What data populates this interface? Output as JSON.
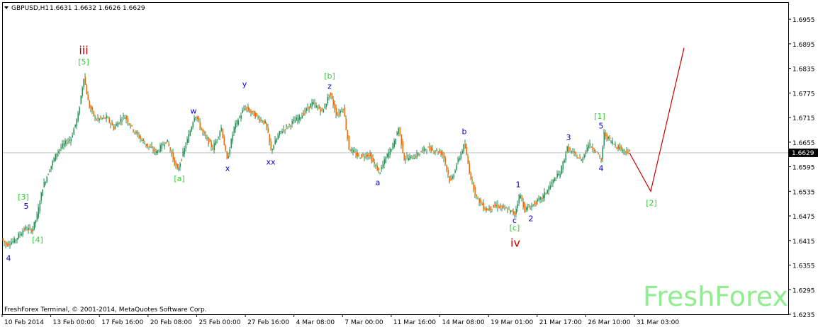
{
  "header": {
    "symbol": "GBPUSD,H1",
    "ohlc": "1.6631 1.6632 1.6626 1.6629"
  },
  "footer": {
    "copyright": "FreshForex Terminal, © 2001-2014, MetaQuotes Software Corp."
  },
  "watermark": "FreshForex",
  "colors": {
    "bull": "#2e8b57",
    "bear": "#ff6600",
    "wick": "#2e8b57",
    "projection": "#cc0000",
    "label_green": "#33cc33",
    "label_blue": "#0000cc",
    "label_red": "#cc0000",
    "current_price_line": "#c8c8c8"
  },
  "chart_data": {
    "type": "candlestick",
    "title": "GBPUSD,H1",
    "ylim": [
      1.6235,
      1.6995
    ],
    "y_ticks": [
      "1.6955",
      "1.6895",
      "1.6835",
      "1.6775",
      "1.6715",
      "1.6655",
      "1.6595",
      "1.6535",
      "1.6475",
      "1.6415",
      "1.6355",
      "1.6295",
      "1.6235"
    ],
    "current_price": "1.6629",
    "x_ticks": [
      "10 Feb 2014",
      "13 Feb 00:00",
      "17 Feb 16:00",
      "20 Feb 08:00",
      "25 Feb 00:00",
      "27 Feb 16:00",
      "4 Mar 08:00",
      "7 Mar 00:00",
      "11 Mar 16:00",
      "14 Mar 08:00",
      "19 Mar 01:00",
      "21 Mar 17:00",
      "26 Mar 10:00",
      "31 Mar 03:00"
    ],
    "price_path": [
      [
        0,
        1.6425
      ],
      [
        8,
        1.6405
      ],
      [
        20,
        1.6415
      ],
      [
        35,
        1.6445
      ],
      [
        45,
        1.644
      ],
      [
        52,
        1.6475
      ],
      [
        60,
        1.6545
      ],
      [
        70,
        1.659
      ],
      [
        80,
        1.663
      ],
      [
        90,
        1.665
      ],
      [
        100,
        1.6665
      ],
      [
        110,
        1.672
      ],
      [
        118,
        1.6815
      ],
      [
        125,
        1.6745
      ],
      [
        135,
        1.671
      ],
      [
        150,
        1.6715
      ],
      [
        160,
        1.669
      ],
      [
        175,
        1.672
      ],
      [
        190,
        1.668
      ],
      [
        205,
        1.665
      ],
      [
        220,
        1.663
      ],
      [
        235,
        1.666
      ],
      [
        250,
        1.6585
      ],
      [
        265,
        1.6665
      ],
      [
        275,
        1.6725
      ],
      [
        285,
        1.668
      ],
      [
        300,
        1.664
      ],
      [
        312,
        1.669
      ],
      [
        320,
        1.661
      ],
      [
        330,
        1.669
      ],
      [
        345,
        1.674
      ],
      [
        360,
        1.672
      ],
      [
        375,
        1.67
      ],
      [
        382,
        1.6635
      ],
      [
        395,
        1.668
      ],
      [
        410,
        1.67
      ],
      [
        425,
        1.672
      ],
      [
        440,
        1.675
      ],
      [
        455,
        1.673
      ],
      [
        465,
        1.6775
      ],
      [
        475,
        1.672
      ],
      [
        484,
        1.674
      ],
      [
        492,
        1.664
      ],
      [
        505,
        1.662
      ],
      [
        520,
        1.6625
      ],
      [
        535,
        1.658
      ],
      [
        545,
        1.662
      ],
      [
        555,
        1.665
      ],
      [
        562,
        1.669
      ],
      [
        570,
        1.6615
      ],
      [
        585,
        1.662
      ],
      [
        600,
        1.664
      ],
      [
        615,
        1.6635
      ],
      [
        625,
        1.6625
      ],
      [
        635,
        1.6555
      ],
      [
        645,
        1.6605
      ],
      [
        655,
        1.665
      ],
      [
        663,
        1.6575
      ],
      [
        672,
        1.652
      ],
      [
        685,
        1.649
      ],
      [
        700,
        1.65
      ],
      [
        715,
        1.649
      ],
      [
        726,
        1.648
      ],
      [
        733,
        1.653
      ],
      [
        740,
        1.649
      ],
      [
        750,
        1.65
      ],
      [
        765,
        1.652
      ],
      [
        780,
        1.656
      ],
      [
        790,
        1.658
      ],
      [
        800,
        1.664
      ],
      [
        810,
        1.6625
      ],
      [
        820,
        1.661
      ],
      [
        830,
        1.665
      ],
      [
        840,
        1.6635
      ],
      [
        848,
        1.661
      ],
      [
        852,
        1.6675
      ],
      [
        860,
        1.666
      ],
      [
        870,
        1.6645
      ],
      [
        880,
        1.6635
      ],
      [
        888,
        1.6629
      ]
    ],
    "projection": [
      [
        888,
        1.6629
      ],
      [
        918,
        1.6535
      ],
      [
        965,
        1.6885
      ]
    ],
    "wave_labels": [
      {
        "text": "iii",
        "x": 118,
        "y": 1.687,
        "color": "red",
        "size": "big"
      },
      {
        "text": "[5]",
        "x": 118,
        "y": 1.6845,
        "color": "green"
      },
      {
        "text": "[3]",
        "x": 33,
        "y": 1.6515,
        "color": "green"
      },
      {
        "text": "5",
        "x": 37,
        "y": 1.6492,
        "color": "blue"
      },
      {
        "text": "[4]",
        "x": 53,
        "y": 1.641,
        "color": "green"
      },
      {
        "text": "4",
        "x": 12,
        "y": 1.6365,
        "color": "blue"
      },
      {
        "text": "w",
        "x": 273,
        "y": 1.6725,
        "color": "blue"
      },
      {
        "text": "[a]",
        "x": 253,
        "y": 1.656,
        "color": "green"
      },
      {
        "text": "x",
        "x": 321,
        "y": 1.6585,
        "color": "blue"
      },
      {
        "text": "y",
        "x": 345,
        "y": 1.679,
        "color": "blue"
      },
      {
        "text": "xx",
        "x": 382,
        "y": 1.66,
        "color": "blue"
      },
      {
        "text": "[b]",
        "x": 465,
        "y": 1.681,
        "color": "green"
      },
      {
        "text": "z",
        "x": 465,
        "y": 1.6785,
        "color": "blue"
      },
      {
        "text": "a",
        "x": 533,
        "y": 1.655,
        "color": "blue"
      },
      {
        "text": "b",
        "x": 655,
        "y": 1.6675,
        "color": "blue"
      },
      {
        "text": "1",
        "x": 731,
        "y": 1.6545,
        "color": "blue"
      },
      {
        "text": "c",
        "x": 726,
        "y": 1.6458,
        "color": "blue"
      },
      {
        "text": "[c]",
        "x": 726,
        "y": 1.644,
        "color": "green"
      },
      {
        "text": "2",
        "x": 749,
        "y": 1.6462,
        "color": "blue"
      },
      {
        "text": "iv",
        "x": 727,
        "y": 1.64,
        "color": "red",
        "size": "big"
      },
      {
        "text": "3",
        "x": 802,
        "y": 1.666,
        "color": "blue"
      },
      {
        "text": "4",
        "x": 848,
        "y": 1.6585,
        "color": "blue"
      },
      {
        "text": "[1]",
        "x": 846,
        "y": 1.6712,
        "color": "green"
      },
      {
        "text": "5",
        "x": 848,
        "y": 1.6688,
        "color": "blue"
      },
      {
        "text": "[2]",
        "x": 919,
        "y": 1.65,
        "color": "green"
      }
    ]
  }
}
